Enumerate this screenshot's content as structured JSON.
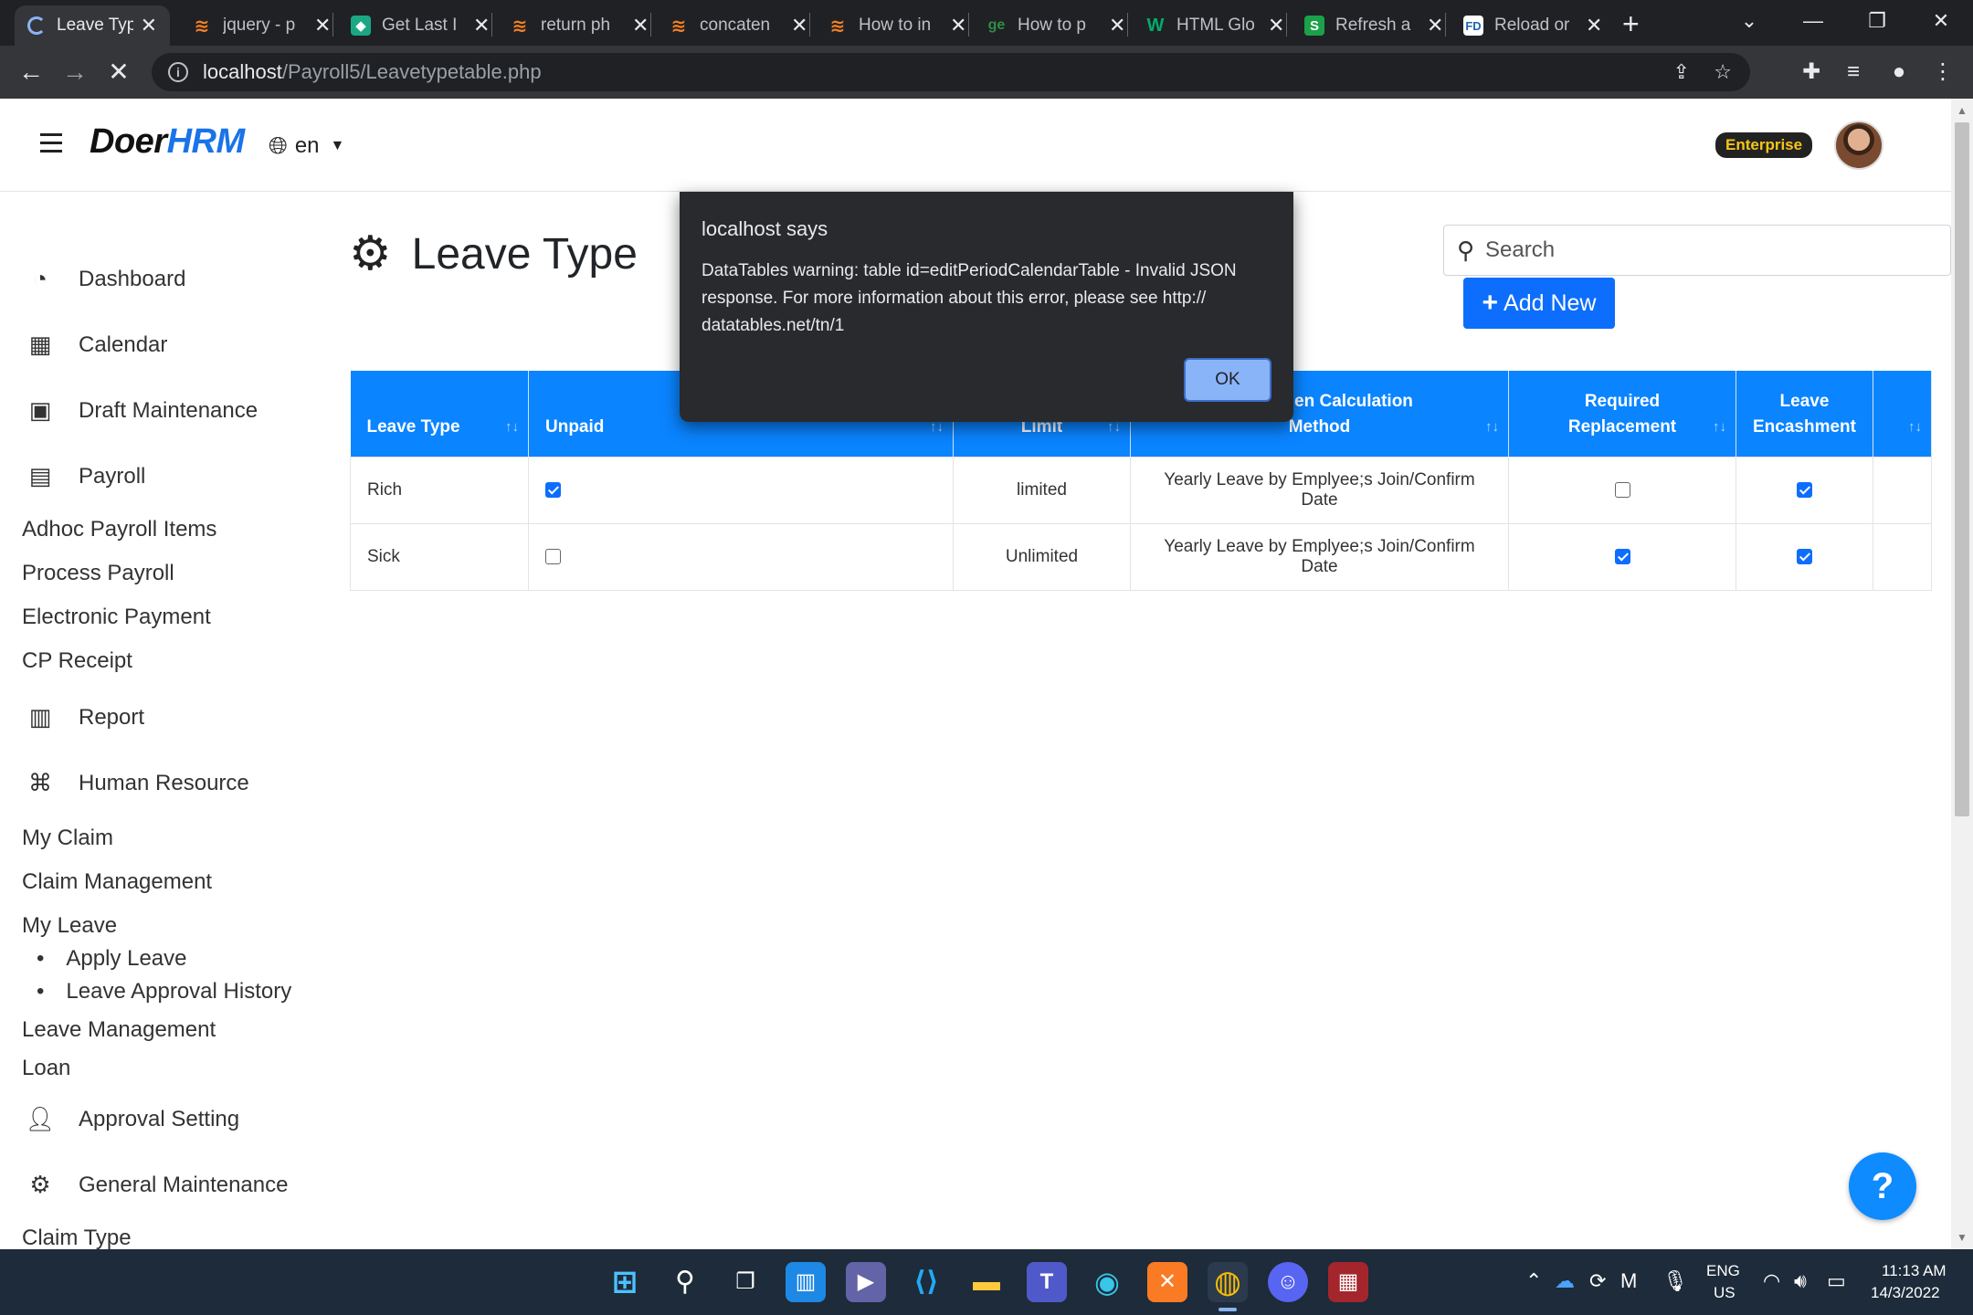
{
  "browser": {
    "tabs": [
      {
        "title": "Leave Typ",
        "favicon": "loading-spinner",
        "color": "#8ab4f8",
        "active": true
      },
      {
        "title": "jquery - p",
        "favicon": "stackoverflow-icon",
        "color": "#f48024"
      },
      {
        "title": "Get Last I",
        "favicon": "shield-icon",
        "color": "#1ba784"
      },
      {
        "title": "return ph",
        "favicon": "stackoverflow-icon",
        "color": "#f48024"
      },
      {
        "title": "concaten",
        "favicon": "stackoverflow-icon",
        "color": "#f48024"
      },
      {
        "title": "How to in",
        "favicon": "stackoverflow-icon",
        "color": "#f48024"
      },
      {
        "title": "How to p",
        "favicon": "geeks-icon",
        "color": "#2f8d46"
      },
      {
        "title": "HTML Glo",
        "favicon": "w3-icon",
        "color": "#04aa6d"
      },
      {
        "title": "Refresh a",
        "favicon": "s-icon",
        "color": "#1aa14a"
      },
      {
        "title": "Reload or",
        "favicon": "fd-icon",
        "color": "#1e63b5"
      }
    ],
    "url_host": "localhost",
    "url_path": "/Payroll5/Leavetypetable.php"
  },
  "header": {
    "logo_doer": "Doer",
    "logo_hrm": "HRM",
    "lang": "en",
    "badge": "Enterprise"
  },
  "sidebar": {
    "dashboard": "Dashboard",
    "calendar": "Calendar",
    "draft": "Draft Maintenance",
    "payroll": "Payroll",
    "adhoc": "Adhoc Payroll Items",
    "process": "Process Payroll",
    "electronic": "Electronic Payment",
    "cp": "CP Receipt",
    "report": "Report",
    "hr": "Human Resource",
    "myclaim": "My Claim",
    "claimmgmt": "Claim Management",
    "myleave": "My Leave",
    "applyleave": "Apply Leave",
    "approvalhist": "Leave Approval History",
    "leavemgmt": "Leave Management",
    "loan": "Loan",
    "approval": "Approval Setting",
    "general": "General Maintenance",
    "claimtype": "Claim Type"
  },
  "main": {
    "title": "Leave Type",
    "search_placeholder": "Search",
    "add_new": "Add New",
    "columns": {
      "leave_type": "Leave Type",
      "unpaid": "Unpaid",
      "limit": "Limit",
      "method_l1": "Entitlemen Calculation",
      "method_l2": "Method",
      "required_l1": "Required",
      "required_l2": "Replacement",
      "encash_l1": "Leave",
      "encash_l2": "Encashment"
    },
    "rows": [
      {
        "leave_type": "Rich",
        "unpaid": true,
        "limit": "limited",
        "method": "Yearly Leave by Emplyee;s Join/Confirm Date",
        "required": false,
        "encash": true
      },
      {
        "leave_type": "Sick",
        "unpaid": false,
        "limit": "Unlimited",
        "method": "Yearly Leave by Emplyee;s Join/Confirm Date",
        "required": true,
        "encash": true
      }
    ],
    "help": "?"
  },
  "dialog": {
    "title": "localhost says",
    "message": "DataTables warning: table id=editPeriodCalendarTable - Invalid JSON response. For more information about this error, please see http:// datatables.net/tn/1",
    "ok": "OK"
  },
  "taskbar": {
    "lang_top": "ENG",
    "lang_bottom": "US",
    "time": "11:13 AM",
    "date": "14/3/2022"
  }
}
